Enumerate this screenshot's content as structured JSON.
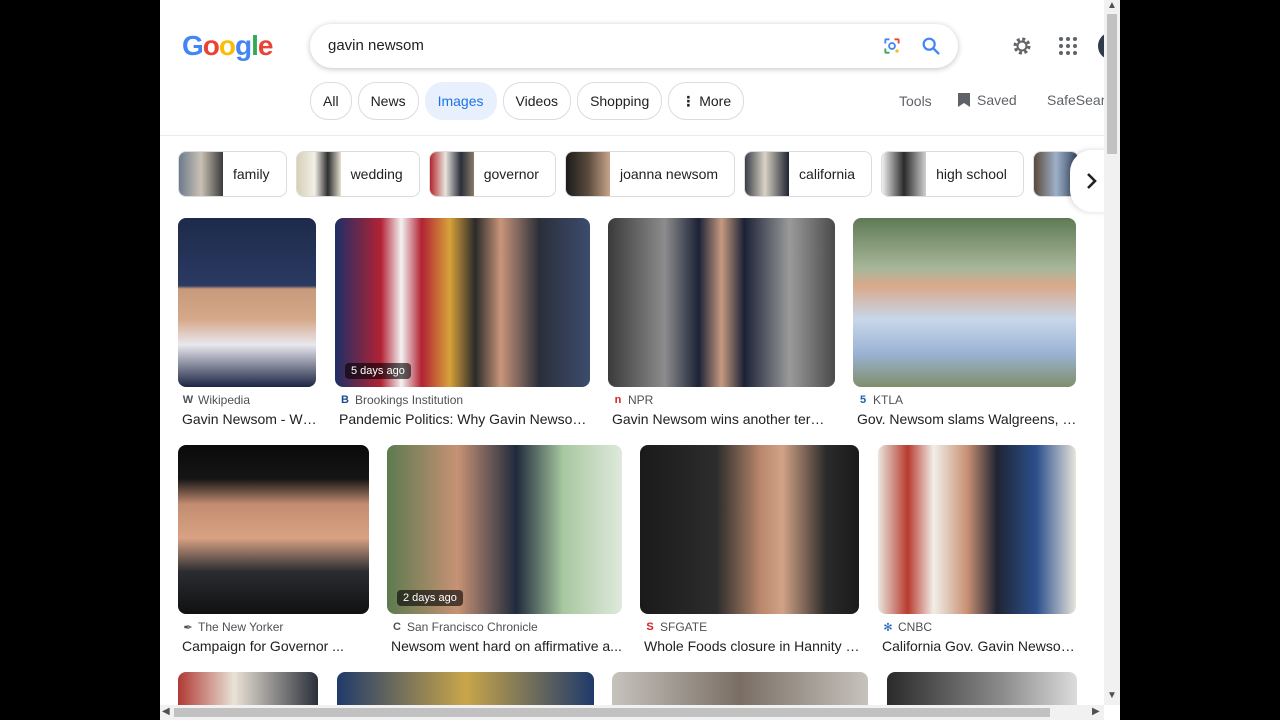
{
  "search": {
    "query": "gavin newsom"
  },
  "tabs": [
    {
      "label": "All",
      "active": false
    },
    {
      "label": "News",
      "active": false
    },
    {
      "label": "Images",
      "active": true
    },
    {
      "label": "Videos",
      "active": false
    },
    {
      "label": "Shopping",
      "active": false
    },
    {
      "label": "More",
      "active": false
    }
  ],
  "toolbar": {
    "tools": "Tools",
    "saved": "Saved",
    "safesearch": "SafeSearch"
  },
  "chips": [
    "family",
    "wedding",
    "governor",
    "joanna newsom",
    "california",
    "high school"
  ],
  "results": [
    {
      "source": "Wikipedia",
      "fav": "W",
      "title": "Gavin Newsom - Wik...",
      "ago": ""
    },
    {
      "source": "Brookings Institution",
      "fav": "B",
      "title": "Pandemic Politics: Why Gavin Newsom ...",
      "ago": "5 days ago"
    },
    {
      "source": "NPR",
      "fav": "n",
      "title": "Gavin Newsom wins another term ...",
      "ago": ""
    },
    {
      "source": "KTLA",
      "fav": "5",
      "title": "Gov. Newsom slams Walgreens, sa...",
      "ago": ""
    },
    {
      "source": "The New Yorker",
      "fav": "✒",
      "title": "Campaign for Governor ...",
      "ago": ""
    },
    {
      "source": "San Francisco Chronicle",
      "fav": "C",
      "title": "Newsom went hard on affirmative a...",
      "ago": "2 days ago"
    },
    {
      "source": "SFGATE",
      "fav": "S",
      "title": "Whole Foods closure in Hannity in...",
      "ago": ""
    },
    {
      "source": "CNBC",
      "fav": "✻",
      "title": "California Gov. Gavin Newsom...",
      "ago": ""
    }
  ]
}
